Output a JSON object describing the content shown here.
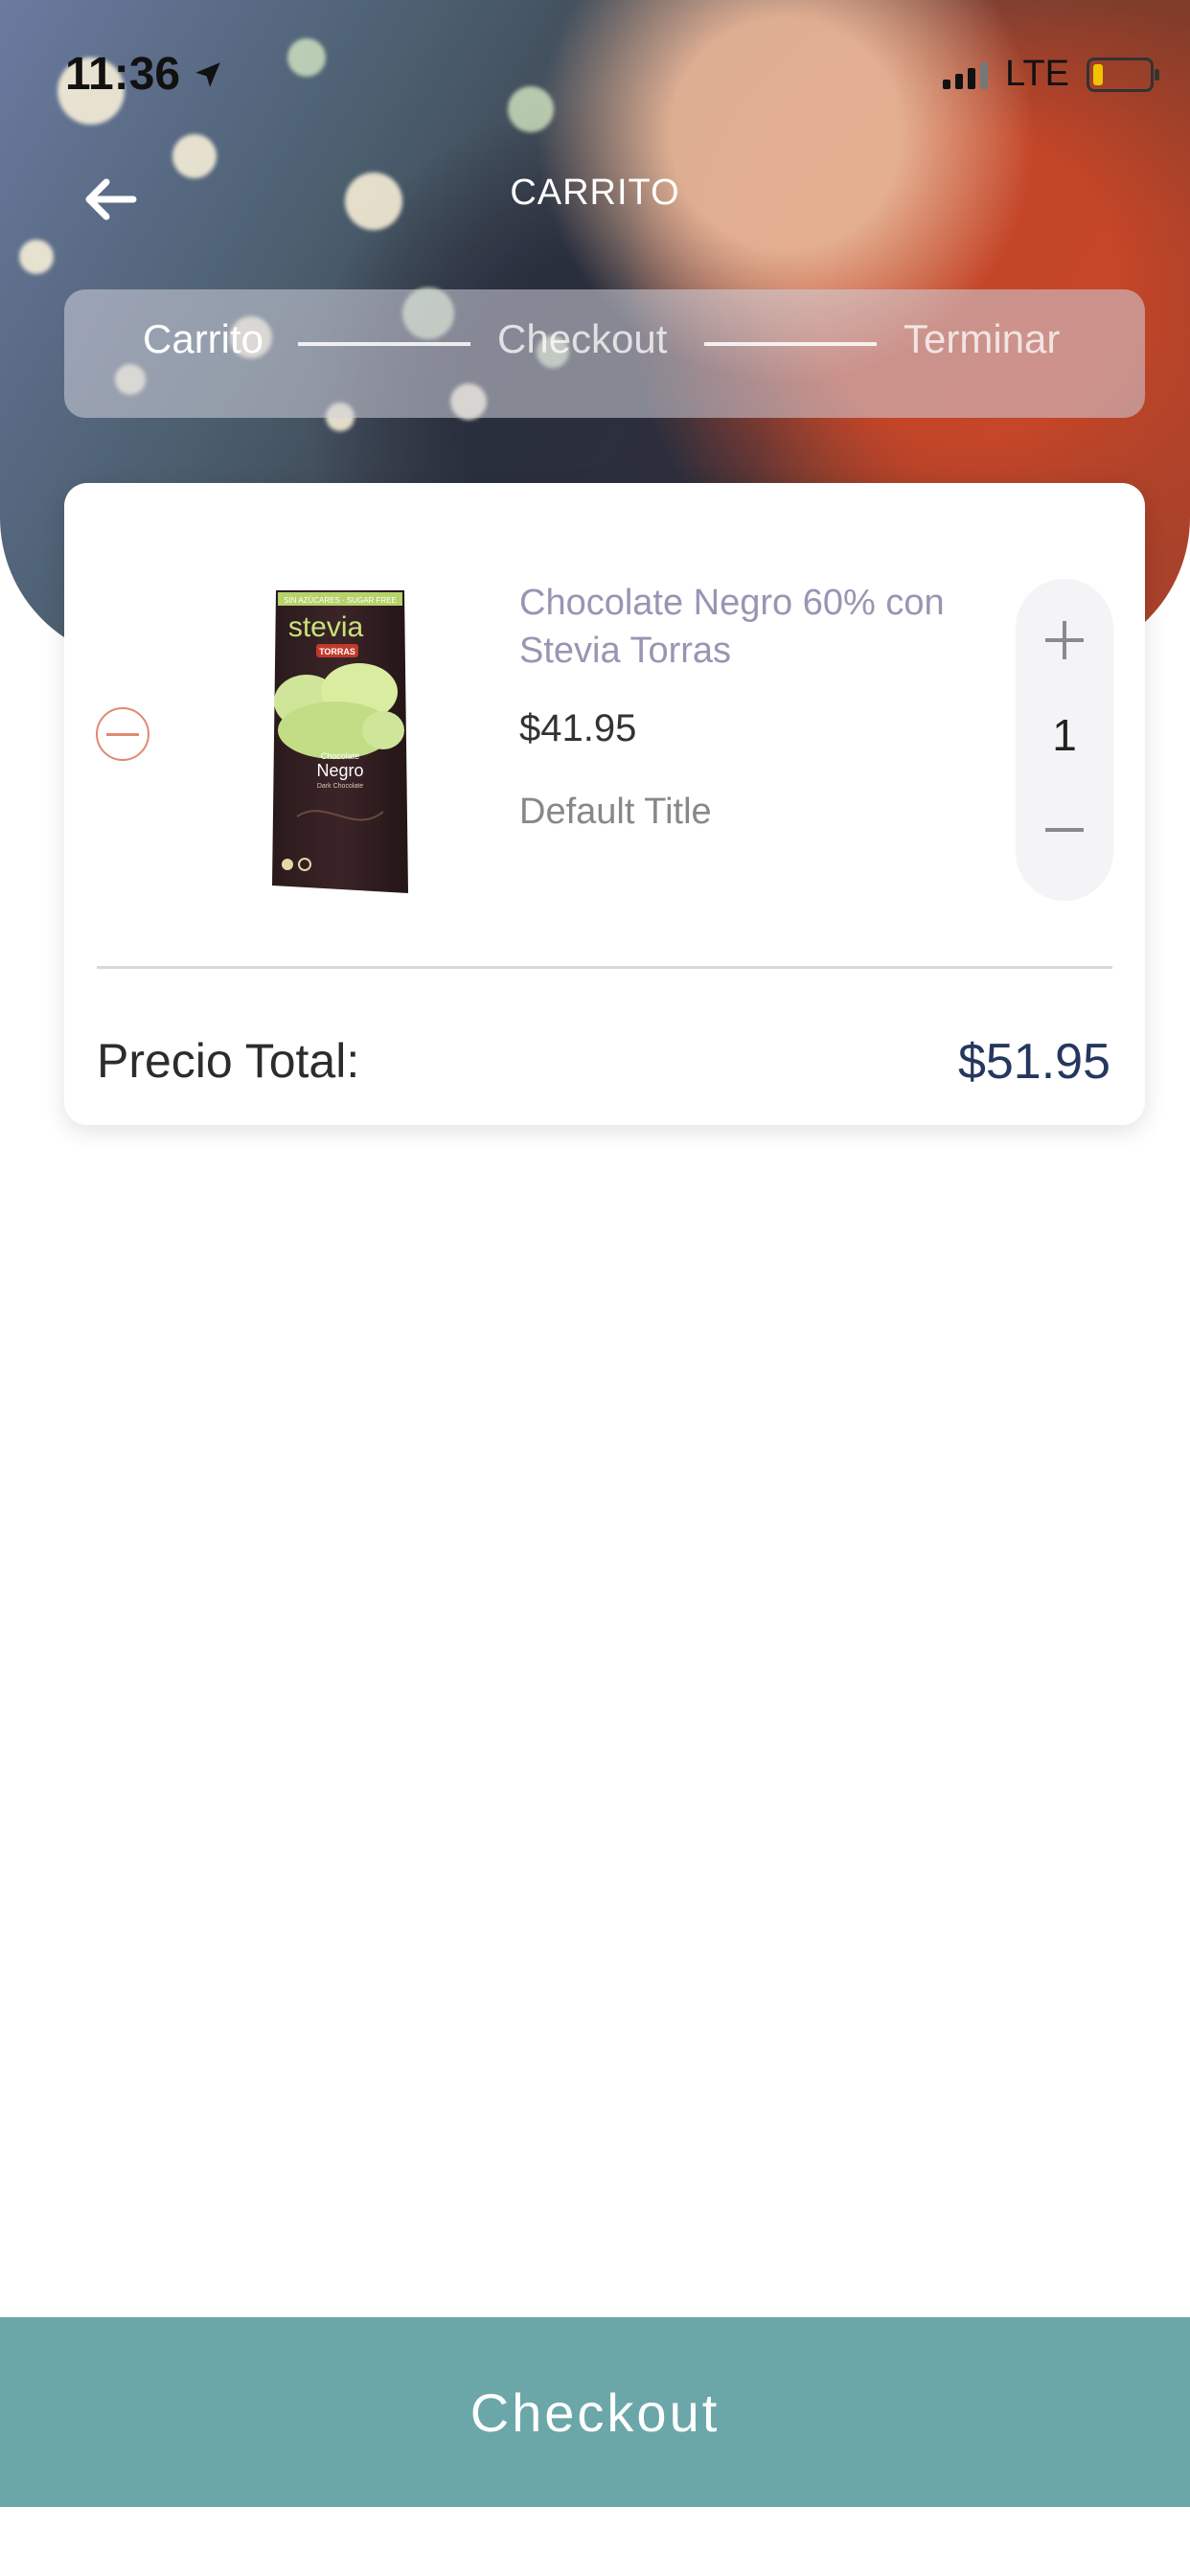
{
  "status_bar": {
    "time": "11:36",
    "network": "LTE"
  },
  "header": {
    "title": "CARRITO",
    "back_icon": "arrow-left-icon"
  },
  "stepper": {
    "steps": [
      {
        "label": "Carrito",
        "active": true
      },
      {
        "label": "Checkout",
        "active": false
      },
      {
        "label": "Terminar",
        "active": false
      }
    ]
  },
  "cart": {
    "items": [
      {
        "name": "Chocolate Negro 60% con Stevia Torras",
        "price": "$41.95",
        "variant": "Default Title",
        "quantity": "1",
        "package_text": {
          "top_banner": "SIN AZÚCARES · SUGAR FREE",
          "brand_line": "stevia",
          "maker": "TORRAS",
          "product_small": "Chocolate",
          "product_big": "Negro",
          "product_sub": "Dark Chocolate"
        }
      }
    ],
    "total_label": "Precio Total:",
    "total_value": "$51.95"
  },
  "checkout_button": {
    "label": "Checkout"
  },
  "colors": {
    "accent": "#6ba7a9",
    "total": "#25375e",
    "remove": "#e08a70",
    "product_name": "#9a94b4"
  }
}
